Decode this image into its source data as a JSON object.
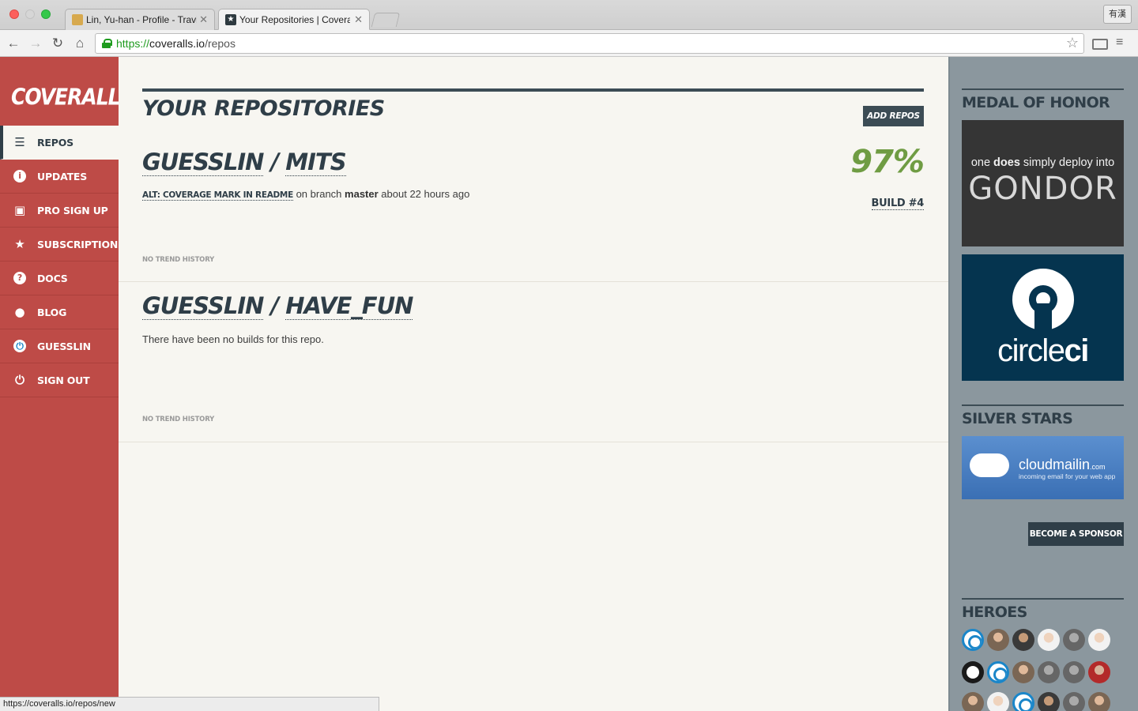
{
  "browser": {
    "tabs": [
      {
        "label": "Lin, Yu-han - Profile - Travi",
        "active": false
      },
      {
        "label": "Your Repositories | Covera",
        "active": true
      }
    ],
    "ime_label": "有漢",
    "url_scheme": "https://",
    "url_host": "coveralls.io",
    "url_path": "/repos",
    "status_url": "https://coveralls.io/repos/new"
  },
  "sidebar": {
    "logo": "COVERALLS",
    "items": [
      {
        "label": "REPOS",
        "icon": "list-icon",
        "active": true
      },
      {
        "label": "UPDATES",
        "icon": "info-icon",
        "active": false
      },
      {
        "label": "PRO SIGN UP",
        "icon": "lock-icon",
        "active": false
      },
      {
        "label": "SUBSCRIPTIONS",
        "icon": "star-icon",
        "active": false
      },
      {
        "label": "DOCS",
        "icon": "question-icon",
        "active": false
      },
      {
        "label": "BLOG",
        "icon": "comment-icon",
        "active": false
      },
      {
        "label": "GUESSLIN",
        "icon": "coveralls-logo-icon",
        "active": false
      },
      {
        "label": "SIGN OUT",
        "icon": "power-icon",
        "active": false
      }
    ]
  },
  "main": {
    "title": "YOUR REPOSITORIES",
    "add_repos_label": "ADD REPOS",
    "repos": [
      {
        "owner": "GUESSLIN",
        "sep": "/",
        "name": "MITS",
        "commit": "ALT: COVERAGE MARK IN README",
        "on_branch": "on branch",
        "branch": "master",
        "time": "about 22 hours ago",
        "coverage": "97%",
        "build": "BUILD #4",
        "trend": "NO TREND HISTORY"
      },
      {
        "owner": "GUESSLIN",
        "sep": "/",
        "name": "HAVE_FUN",
        "no_builds": "There have been no builds for this repo.",
        "trend": "NO TREND HISTORY"
      }
    ]
  },
  "rail": {
    "medal_heading": "MEDAL OF HONOR",
    "gondor": {
      "pre": "one",
      "bold": "does",
      "post": "simply deploy into",
      "big": "GONDOR"
    },
    "circleci": {
      "word_a": "circle",
      "word_b": "ci"
    },
    "silver_heading": "SILVER STARS",
    "cloudmailin": {
      "name": "cloudmailin",
      "tld": ".com",
      "tagline": "incoming email for your web app"
    },
    "sponsor_label": "BECOME A SPONSOR",
    "heroes_heading": "HEROES"
  },
  "colors": {
    "sidebar_red": "#be4b47",
    "ink": "#2f3e48",
    "coverage_green": "#6f9c43",
    "rail_gray": "#8b979e"
  }
}
